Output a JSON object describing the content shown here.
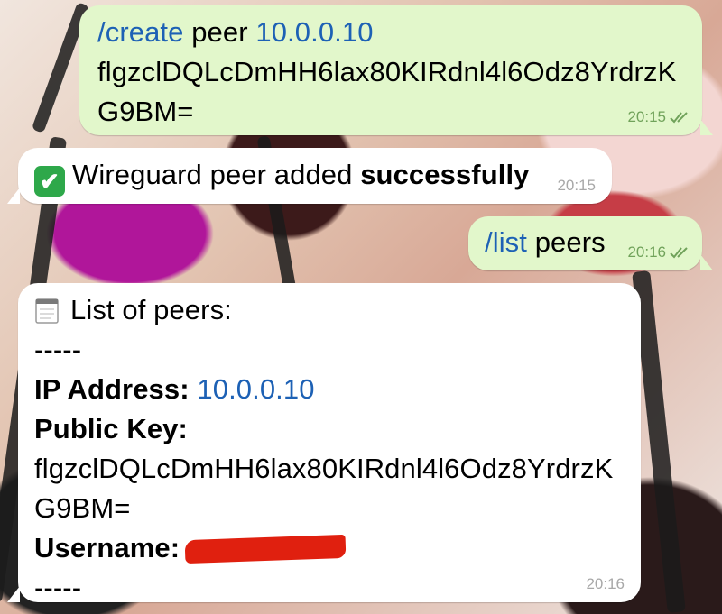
{
  "messages": [
    {
      "direction": "outgoing",
      "command": "/create",
      "text": "peer",
      "ip": "10.0.0.10",
      "key_line1": "flgzclDQLcDmHH6lax80KIRdnl4l6Odz8YrdrzK",
      "key_line2": "G9BM=",
      "time": "20:15",
      "status": "read"
    },
    {
      "direction": "incoming",
      "emoji": "✔",
      "text": "Wireguard peer added",
      "text_bold": "successfully",
      "time": "20:15"
    },
    {
      "direction": "outgoing",
      "command": "/list",
      "text": "peers",
      "time": "20:16",
      "status": "read"
    },
    {
      "direction": "incoming",
      "header": "List of peers:",
      "divider": "-----",
      "ip_label": "IP Address:",
      "ip_value": "10.0.0.10",
      "key_label": "Public Key:",
      "key_line1": "flgzclDQLcDmHH6lax80KIRdnl4l6Odz8YrdrzK",
      "key_line2": "G9BM=",
      "username_label": "Username:",
      "username_value": "[redacted]",
      "divider_end": "-----",
      "time": "20:16"
    }
  ],
  "icons": {
    "read_receipt": "double-check-icon",
    "success": "check-mark-button-icon",
    "notepad": "notepad-icon"
  },
  "colors": {
    "outgoing_bubble": "#e2f7cb",
    "incoming_bubble": "#ffffff",
    "command_link": "#1d61b5",
    "read_status": "#70a25a",
    "redaction": "#e0200f"
  }
}
